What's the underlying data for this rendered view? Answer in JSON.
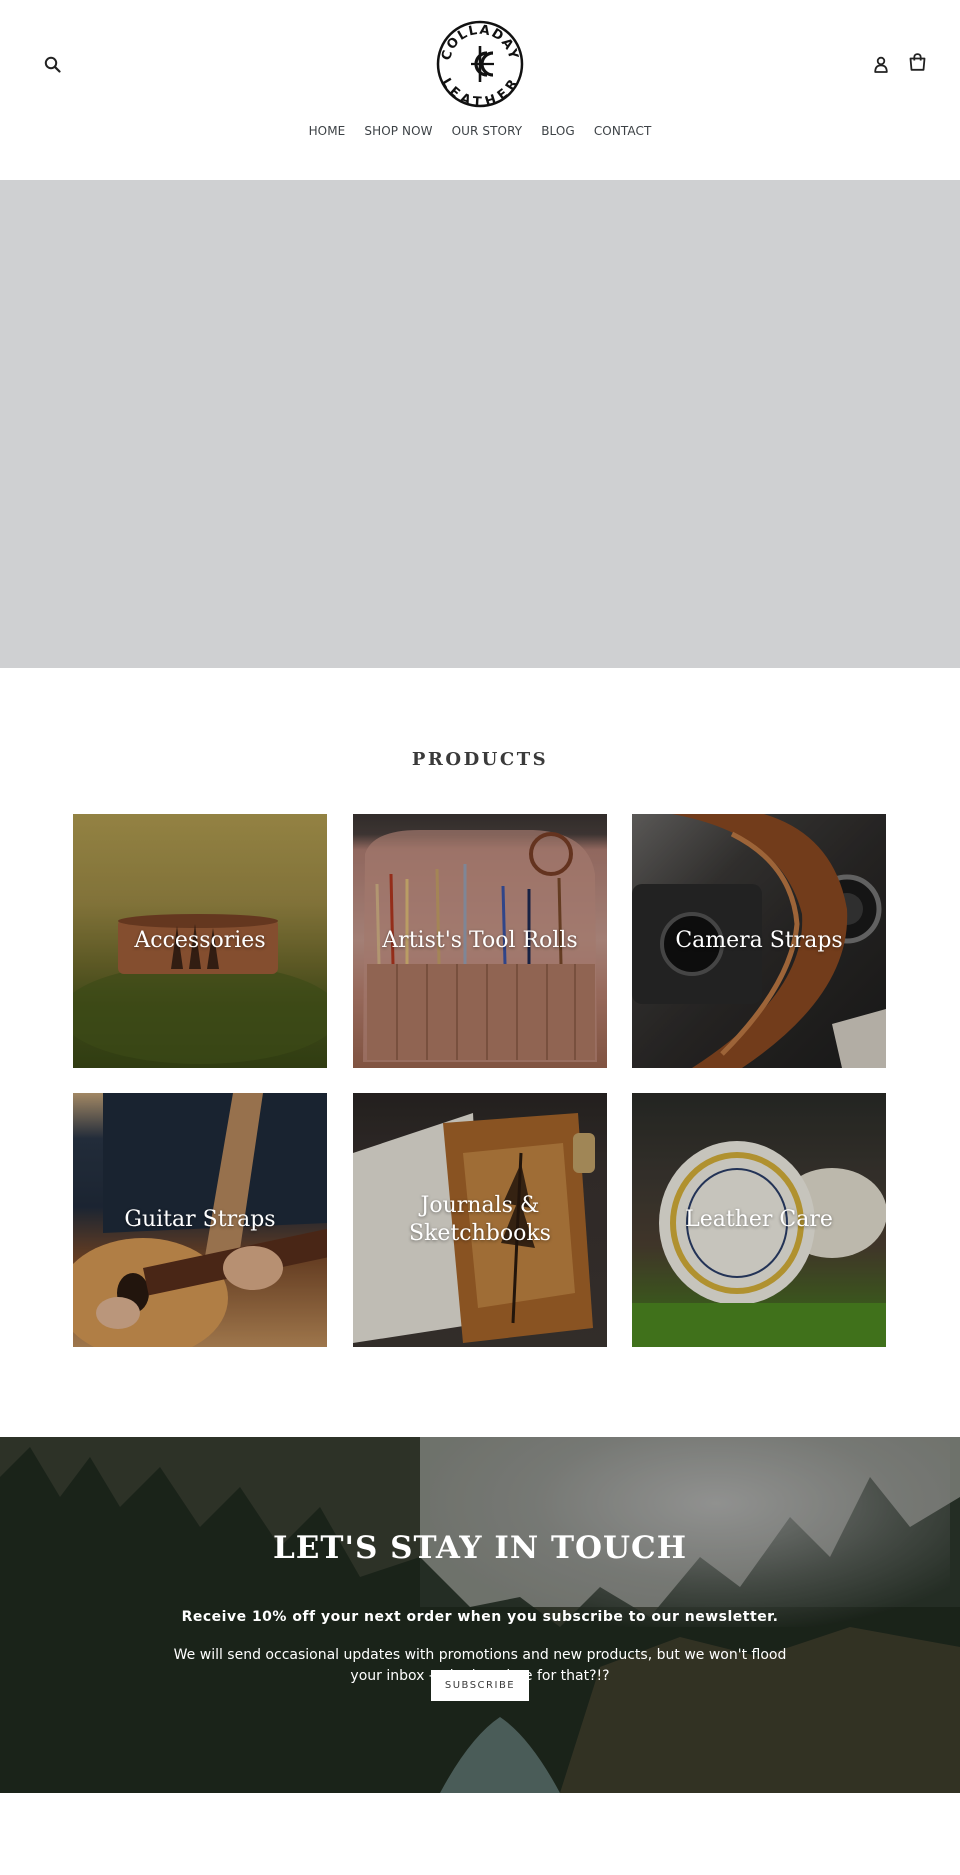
{
  "header": {
    "logo": {
      "top_text": "COLLADAY",
      "bottom_text": "LEATHER",
      "monogram": "CC"
    },
    "icons": {
      "search": "search-icon",
      "account": "user-icon",
      "cart": "shopping-bag-icon"
    }
  },
  "nav": {
    "items": [
      {
        "label": "HOME"
      },
      {
        "label": "SHOP NOW"
      },
      {
        "label": "OUR STORY"
      },
      {
        "label": "BLOG"
      },
      {
        "label": "CONTACT"
      }
    ]
  },
  "products": {
    "title": "PRODUCTS",
    "collections": [
      {
        "label": "Accessories"
      },
      {
        "label": "Artist's Tool Rolls"
      },
      {
        "label": "Camera Straps"
      },
      {
        "label": "Guitar Straps"
      },
      {
        "label": "Journals & Sketchbooks"
      },
      {
        "label": "Leather Care"
      }
    ]
  },
  "newsletter": {
    "title": "LET'S STAY IN TOUCH",
    "subtitle": "Receive 10% off your next order when you subscribe to our newsletter.",
    "body": "We will send occasional updates with promotions and new products, but we won't flood your inbox - who has time for that?!?",
    "button_label": "SUBSCRIBE"
  },
  "colors": {
    "hero_placeholder": "#cfd0d2",
    "text": "#3a3a3a",
    "white": "#ffffff"
  }
}
